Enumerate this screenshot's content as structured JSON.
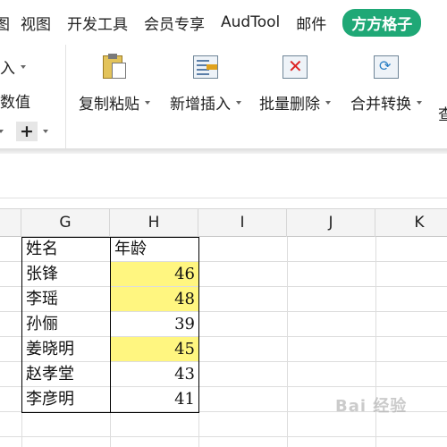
{
  "menubar": {
    "items": [
      "视图",
      "开发工具",
      "会员专享",
      "AudTool",
      "邮件"
    ],
    "active": "方方格子"
  },
  "ribbon": {
    "left_group": {
      "row1": "入",
      "row2": "数值",
      "plus": "+"
    },
    "tools": [
      {
        "label": "复制粘贴",
        "icon": "paste-icon"
      },
      {
        "label": "新增插入",
        "icon": "insert-icon"
      },
      {
        "label": "批量删除",
        "icon": "delete-icon"
      },
      {
        "label": "合并转换",
        "icon": "merge-convert-icon"
      }
    ],
    "overflow_label": "查"
  },
  "sheet": {
    "columns": [
      "G",
      "H",
      "I",
      "J",
      "K"
    ],
    "header": {
      "name": "姓名",
      "age": "年龄"
    },
    "rows": [
      {
        "name": "张锋",
        "age": "46",
        "highlight": true
      },
      {
        "name": "李瑶",
        "age": "48",
        "highlight": true
      },
      {
        "name": "孙俪",
        "age": "39",
        "highlight": false
      },
      {
        "name": "姜晓明",
        "age": "45",
        "highlight": true
      },
      {
        "name": "赵孝堂",
        "age": "43",
        "highlight": false
      },
      {
        "name": "李彦明",
        "age": "41",
        "highlight": false
      }
    ],
    "highlight_color": "#fff680"
  },
  "watermark": "Bai 经验"
}
